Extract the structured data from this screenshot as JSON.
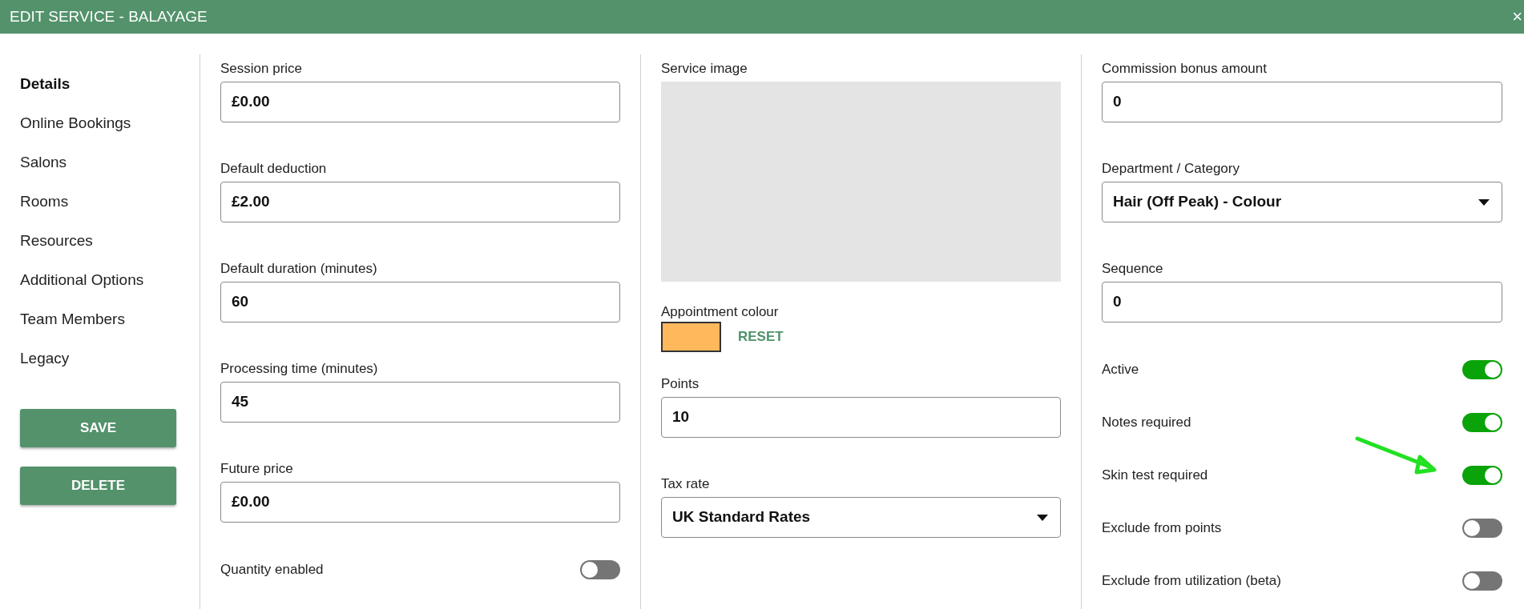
{
  "window": {
    "title": "EDIT SERVICE - BALAYAGE",
    "close": "×"
  },
  "sidebar": {
    "items": [
      {
        "label": "Details",
        "selected": true
      },
      {
        "label": "Online Bookings",
        "selected": false
      },
      {
        "label": "Salons",
        "selected": false
      },
      {
        "label": "Rooms",
        "selected": false
      },
      {
        "label": "Resources",
        "selected": false
      },
      {
        "label": "Additional Options",
        "selected": false
      },
      {
        "label": "Team Members",
        "selected": false
      },
      {
        "label": "Legacy",
        "selected": false
      }
    ],
    "buttons": [
      "SAVE",
      "DELETE"
    ]
  },
  "columns": [
    {
      "fields": [
        {
          "kind": "text",
          "label": "Session price",
          "value": "£0.00"
        },
        {
          "kind": "text",
          "label": "Default deduction",
          "value": "£2.00"
        },
        {
          "kind": "text",
          "label": "Default duration (minutes)",
          "value": "60"
        },
        {
          "kind": "text",
          "label": "Processing time (minutes)",
          "value": "45"
        },
        {
          "kind": "text",
          "label": "Future price",
          "value": "£0.00"
        }
      ],
      "toggles": [
        {
          "label": "Quantity enabled",
          "on": false
        }
      ]
    },
    {
      "fields": [
        {
          "kind": "image",
          "label": "Service image"
        },
        {
          "kind": "colour",
          "label": "Appointment colour",
          "color": "#ffb85c",
          "action": "RESET"
        },
        {
          "kind": "text",
          "label": "Points",
          "value": "10"
        },
        {
          "kind": "select",
          "label": "Tax rate",
          "value": "UK Standard Rates"
        }
      ]
    },
    {
      "fields": [
        {
          "kind": "text",
          "label": "Commission bonus amount",
          "value": "0"
        },
        {
          "kind": "select",
          "label": "Department / Category",
          "value": "Hair (Off Peak) - Colour"
        },
        {
          "kind": "text",
          "label": "Sequence",
          "value": "0"
        }
      ],
      "toggles": [
        {
          "label": "Active",
          "on": true
        },
        {
          "label": "Notes required",
          "on": true
        },
        {
          "label": "Skin test required",
          "on": true
        },
        {
          "label": "Exclude from points",
          "on": false
        },
        {
          "label": "Exclude from utilization (beta)",
          "on": false
        }
      ]
    }
  ]
}
